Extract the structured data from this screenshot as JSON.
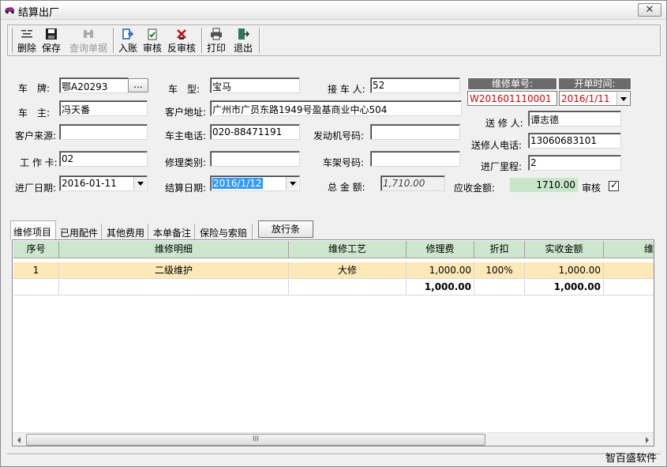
{
  "window": {
    "title": "结算出厂",
    "close_label": "✕"
  },
  "toolbar": {
    "buttons": [
      {
        "label": "删除",
        "icon": "delete-icon"
      },
      {
        "label": "保存",
        "icon": "save-icon"
      },
      {
        "label": "查询单据",
        "icon": "binoculars-icon",
        "disabled": true
      },
      {
        "label": "入账",
        "icon": "post-account-icon"
      },
      {
        "label": "审核",
        "icon": "audit-icon"
      },
      {
        "label": "反审核",
        "icon": "unaudit-icon"
      },
      {
        "label": "打印",
        "icon": "print-icon"
      },
      {
        "label": "退出",
        "icon": "exit-icon"
      }
    ]
  },
  "form": {
    "plate_label": "车　牌:",
    "plate_value": "鄂A20293",
    "plate_btn": "...",
    "owner_label": "车　主:",
    "owner_value": "冯天番",
    "source_label": "客户来源:",
    "source_value": "",
    "card_label": "工 作 卡:",
    "card_value": "02",
    "entry_date_label": "进厂日期:",
    "entry_date_value": "2016-01-11",
    "model_label": "车　型:",
    "model_value": "宝马",
    "address_label": "客户地址:",
    "address_value": "广州市广员东路1949号盈基商业中心504",
    "phone_label": "车主电话:",
    "phone_value": "020-88471191",
    "repair_type_label": "修理类别:",
    "repair_type_value": "",
    "settle_date_label": "结算日期:",
    "settle_date_value": "2016/1/12",
    "receiver_label": "接 车 人:",
    "receiver_value": "52",
    "engine_label": "发动机号码:",
    "engine_value": "",
    "frame_label": "车架号码:",
    "frame_value": "",
    "total_label": "总 金 额:",
    "total_value": "1,710.00",
    "repair_no_header": "维修单号:",
    "repair_no_value": "W201601110001",
    "open_time_header": "开单时间:",
    "open_time_value": "2016/1/11",
    "sender_label": "送 修 人:",
    "sender_value": "谭志德",
    "sender_phone_label": "送修人电话:",
    "sender_phone_value": "13060683101",
    "mileage_label": "进厂里程:",
    "mileage_value": "2",
    "receivable_label": "应收金额:",
    "receivable_value": "1710.00",
    "audit_label": "审核",
    "audit_checked": "✓"
  },
  "tabs": [
    "维修项目",
    "已用配件",
    "其他费用",
    "本单备注",
    "保险与索赔"
  ],
  "release_button": "放行条",
  "grid": {
    "headers": [
      "序号",
      "维修明细",
      "维修工艺",
      "修理费",
      "折扣",
      "实收金额",
      "维"
    ],
    "rows": [
      [
        "1",
        "二级维护",
        "大修",
        "1,000.00",
        "100%",
        "1,000.00"
      ]
    ],
    "totals": [
      "",
      "",
      "",
      "1,000.00",
      "",
      "1,000.00"
    ]
  },
  "scrollbar_grip": "III",
  "footer": {
    "company": "智百盛软件"
  }
}
